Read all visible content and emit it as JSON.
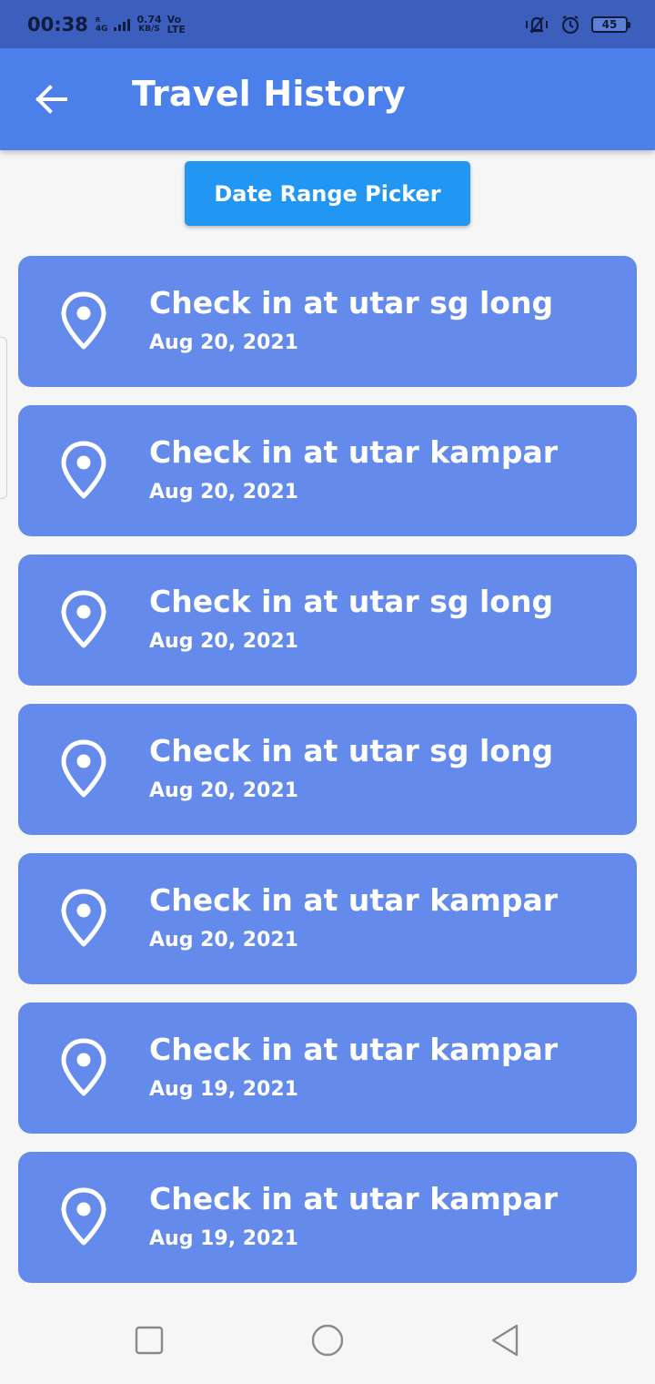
{
  "status_bar": {
    "time": "00:38",
    "network_type": "4G",
    "network_sub": "R",
    "speed_value": "0.74",
    "speed_unit": "KB/S",
    "volte_top": "Vo",
    "volte_bottom": "LTE",
    "battery": "45"
  },
  "app_bar": {
    "title": "Travel History",
    "back_icon": "arrow-left-icon"
  },
  "date_button": {
    "label": "Date Range Picker"
  },
  "history": [
    {
      "title": "Check in at utar sg long",
      "date": "Aug 20, 2021",
      "icon": "location-pin-icon"
    },
    {
      "title": "Check in at utar kampar",
      "date": "Aug 20, 2021",
      "icon": "location-pin-icon"
    },
    {
      "title": "Check in at utar sg long",
      "date": "Aug 20, 2021",
      "icon": "location-pin-icon"
    },
    {
      "title": "Check in at utar sg long",
      "date": "Aug 20, 2021",
      "icon": "location-pin-icon"
    },
    {
      "title": "Check in at utar kampar",
      "date": "Aug 20, 2021",
      "icon": "location-pin-icon"
    },
    {
      "title": "Check in at utar kampar",
      "date": "Aug 19, 2021",
      "icon": "location-pin-icon"
    },
    {
      "title": "Check in at utar kampar",
      "date": "Aug 19, 2021",
      "icon": "location-pin-icon"
    }
  ],
  "nav_bar": {
    "recents_icon": "square-icon",
    "home_icon": "circle-icon",
    "back_icon": "triangle-back-icon"
  },
  "colors": {
    "status_bar": "#3c5fbd",
    "app_bar": "#4b7fea",
    "button": "#2196f3",
    "card": "#648bec",
    "background": "#f6f6f6"
  }
}
